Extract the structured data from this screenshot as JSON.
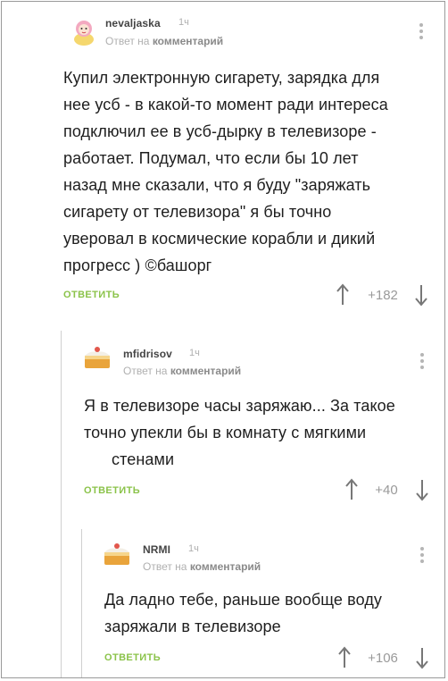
{
  "comments": [
    {
      "author": "nevaljaska",
      "time": "1ч",
      "reply_prefix": "Ответ на",
      "reply_target": "комментарий",
      "text_lines": [
        "Купил электронную сигарету, зарядка для",
        "нее усб - в какой-то момент ради интереса",
        "подключил ее в усб-дырку в телевизоре -",
        "работает. Подумал, что если бы 10 лет",
        "назад мне сказали, что я буду \"заряжать",
        "сигарету от телевизора\" я бы точно",
        "уверовал в космические корабли и дикий",
        "прогресс ) ©башорг"
      ],
      "reply_label": "ОТВЕТИТЬ",
      "rating": "+182",
      "avatar_icon": "doll-avatar-icon"
    },
    {
      "author": "mfidrisov",
      "time": "1ч",
      "reply_prefix": "Ответ на",
      "reply_target": "комментарий",
      "text_lines": [
        "Я в телевизоре часы заряжаю... За такое",
        "точно упекли бы в комнату с мягкими",
        "стенами"
      ],
      "reply_label": "ОТВЕТИТЬ",
      "rating": "+40",
      "avatar_icon": "cake-avatar-icon"
    },
    {
      "author": "NRMI",
      "time": "1ч",
      "reply_prefix": "Ответ на",
      "reply_target": "комментарий",
      "text_lines": [
        "Да ладно тебе, раньше вообще воду",
        "заряжали в телевизоре"
      ],
      "reply_label": "ОТВЕТИТЬ",
      "rating": "+106",
      "avatar_icon": "cake-avatar-icon"
    }
  ],
  "colors": {
    "accent_green": "#8bc34a",
    "muted_gray": "#b0b0b0",
    "thread_line": "#cfcfcf"
  }
}
